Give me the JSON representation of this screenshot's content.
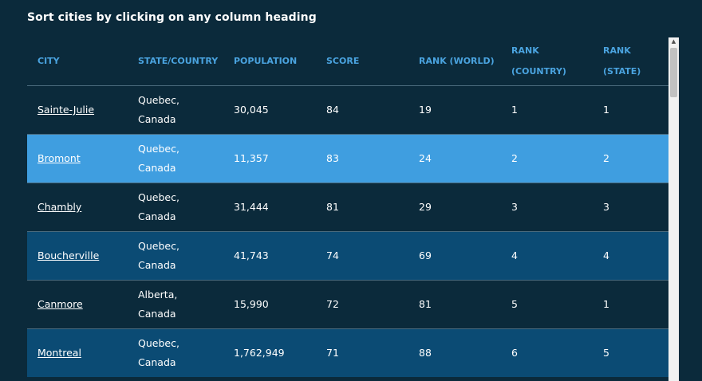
{
  "heading": "Sort cities by clicking on any column heading",
  "table": {
    "headers": [
      "CITY",
      "STATE/COUNTRY",
      "POPULATION",
      "SCORE",
      "RANK (WORLD)",
      "RANK (COUNTRY)",
      "RANK (STATE)"
    ],
    "rows": [
      {
        "city": "Sainte-Julie",
        "state": "Quebec,",
        "country": "Canada",
        "population": "30,045",
        "score": "84",
        "rank_world": "19",
        "rank_country": "1",
        "rank_state": "1"
      },
      {
        "city": "Bromont",
        "state": "Quebec,",
        "country": "Canada",
        "population": "11,357",
        "score": "83",
        "rank_world": "24",
        "rank_country": "2",
        "rank_state": "2"
      },
      {
        "city": "Chambly",
        "state": "Quebec,",
        "country": "Canada",
        "population": "31,444",
        "score": "81",
        "rank_world": "29",
        "rank_country": "3",
        "rank_state": "3"
      },
      {
        "city": "Boucherville",
        "state": "Quebec,",
        "country": "Canada",
        "population": "41,743",
        "score": "74",
        "rank_world": "69",
        "rank_country": "4",
        "rank_state": "4"
      },
      {
        "city": "Canmore",
        "state": "Alberta,",
        "country": "Canada",
        "population": "15,990",
        "score": "72",
        "rank_world": "81",
        "rank_country": "5",
        "rank_state": "1"
      },
      {
        "city": "Montreal",
        "state": "Quebec,",
        "country": "Canada",
        "population": "1,762,949",
        "score": "71",
        "rank_world": "88",
        "rank_country": "6",
        "rank_state": "5"
      }
    ]
  },
  "colors": {
    "background": "#0b2a3b",
    "header_text": "#4aa3df",
    "row_highlight": "#3f9ee0",
    "row_alt": "#0b4b74"
  },
  "icons": {
    "scroll_up": "▲"
  }
}
